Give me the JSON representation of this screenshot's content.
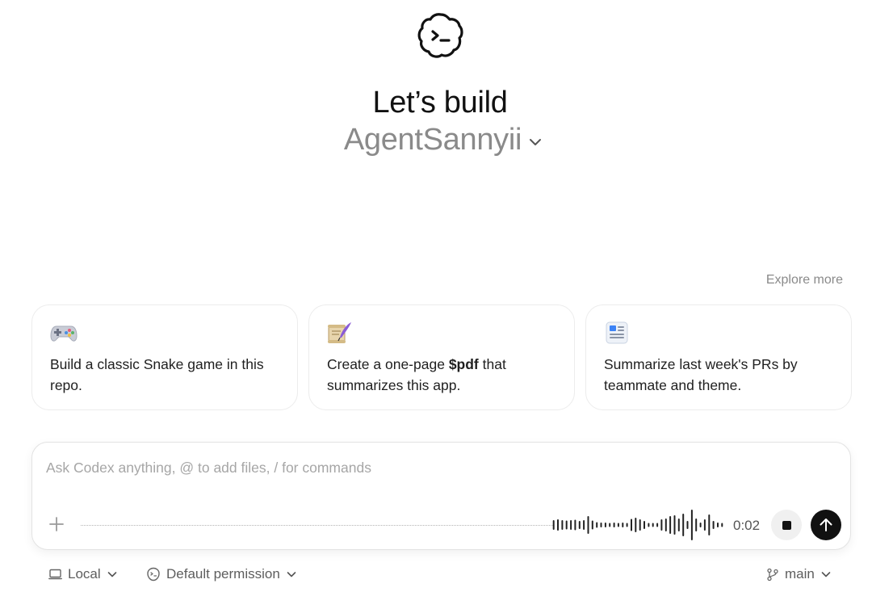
{
  "header": {
    "title": "Let’s build",
    "project_name": "AgentSannyii"
  },
  "suggestions": {
    "explore_label": "Explore more",
    "cards": [
      {
        "icon": "game-controller-icon",
        "text": "Build a classic Snake game in this repo."
      },
      {
        "icon": "scroll-quill-icon",
        "text_before": "Create a one-page ",
        "text_bold": "$pdf",
        "text_after": " that summarizes this app."
      },
      {
        "icon": "document-list-icon",
        "text": "Summarize last week's PRs by teammate and theme."
      }
    ]
  },
  "composer": {
    "placeholder": "Ask Codex anything, @ to add files, / for commands",
    "recording_time": "0:02"
  },
  "footer": {
    "environment": "Local",
    "permission": "Default permission",
    "branch": "main"
  }
}
